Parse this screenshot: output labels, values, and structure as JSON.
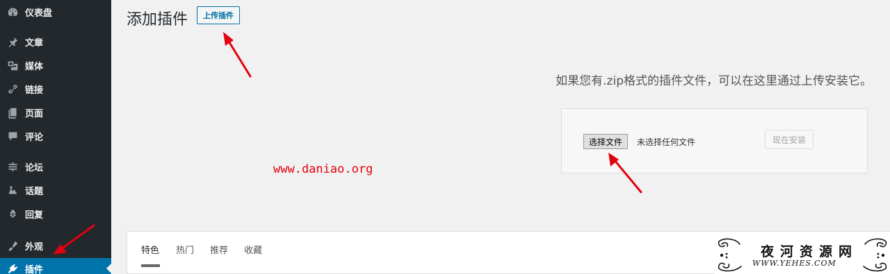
{
  "sidebar": {
    "items": [
      {
        "label": "仪表盘",
        "icon": "dashboard-icon"
      },
      {
        "label": "文章",
        "icon": "pin-icon"
      },
      {
        "label": "媒体",
        "icon": "media-icon"
      },
      {
        "label": "链接",
        "icon": "link-icon"
      },
      {
        "label": "页面",
        "icon": "page-icon"
      },
      {
        "label": "评论",
        "icon": "comment-icon"
      },
      {
        "label": "论坛",
        "icon": "forum-icon"
      },
      {
        "label": "话题",
        "icon": "topic-icon"
      },
      {
        "label": "回复",
        "icon": "reply-icon"
      },
      {
        "label": "外观",
        "icon": "appearance-icon"
      },
      {
        "label": "插件",
        "icon": "plugin-icon",
        "active": true
      }
    ]
  },
  "header": {
    "title": "添加插件",
    "upload_button": "上传插件"
  },
  "upload": {
    "hint": "如果您有.zip格式的插件文件，可以在这里通过上传安装它。",
    "choose_file": "选择文件",
    "no_file": "未选择任何文件",
    "install_now": "现在安装"
  },
  "watermark": {
    "url": "www.daniao.org"
  },
  "filters": {
    "tabs": [
      "特色",
      "热门",
      "推荐",
      "收藏"
    ]
  },
  "logo": {
    "title": "夜河资源网",
    "subtitle": "WWW.YEHES.COM"
  },
  "colors": {
    "sidebar_bg": "#23282d",
    "active_bg": "#0073aa",
    "annotation": "#e3000f"
  }
}
